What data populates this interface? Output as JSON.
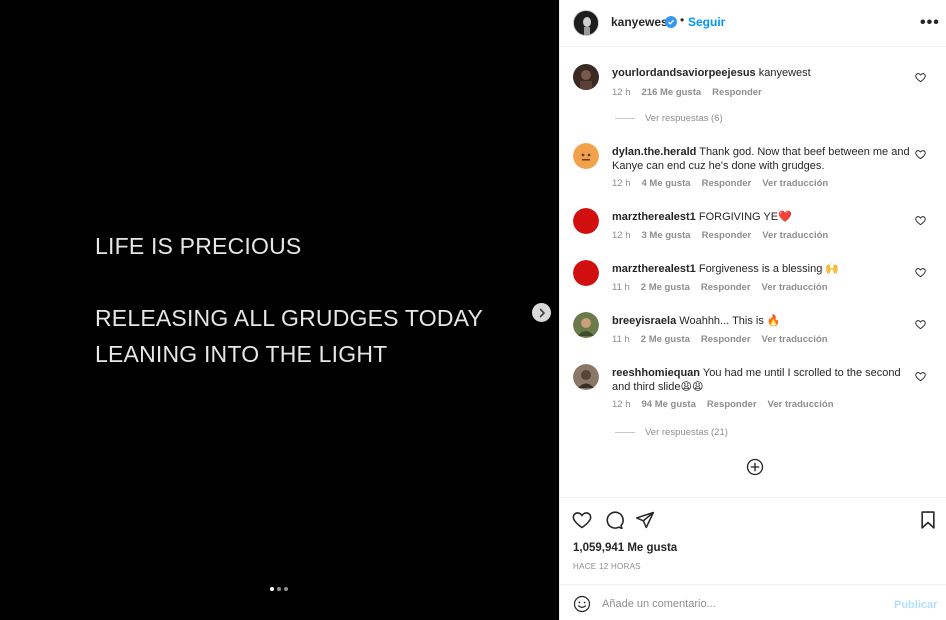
{
  "slide": {
    "lines": [
      "LIFE IS PRECIOUS",
      "RELEASING ALL GRUDGES TODAY",
      "LEANING INTO THE LIGHT"
    ],
    "dots": 3,
    "active_dot": 0
  },
  "header": {
    "username": "kanyewest",
    "separator": "•",
    "follow_label": "Seguir",
    "more_label": "•••"
  },
  "comments": [
    {
      "user": "yourlordandsaviorpeejesus",
      "text": "kanyewest",
      "time": "12 h",
      "likes": "216 Me gusta",
      "reply": "Responder",
      "translate": "",
      "avatar_color": "#3a2a22"
    },
    {
      "user": "dylan.the.herald",
      "text": "Thank god. Now that beef between me and Kanye can end cuz he's done with grudges.",
      "time": "12 h",
      "likes": "4 Me gusta",
      "reply": "Responder",
      "translate": "Ver traducción",
      "avatar_color": "#f5a04a"
    },
    {
      "user": "marztherealest1",
      "text": "FORGIVING YE❤️",
      "time": "12 h",
      "likes": "3 Me gusta",
      "reply": "Responder",
      "translate": "Ver traducción",
      "avatar_color": "#d10f0f"
    },
    {
      "user": "marztherealest1",
      "text": "Forgiveness is a blessing 🙌",
      "time": "11 h",
      "likes": "2 Me gusta",
      "reply": "Responder",
      "translate": "Ver traducción",
      "avatar_color": "#d10f0f"
    },
    {
      "user": "breeyisraela",
      "text": "Woahhh... This is 🔥",
      "time": "11 h",
      "likes": "2 Me gusta",
      "reply": "Responder",
      "translate": "Ver traducción",
      "avatar_color": "#6b7a4a"
    },
    {
      "user": "reeshhomiequan",
      "text": "You had me until I scrolled to the second and third slide😩😩",
      "time": "12 h",
      "likes": "94 Me gusta",
      "reply": "Responder",
      "translate": "Ver traducción",
      "avatar_color": "#7a6a5a"
    }
  ],
  "replies": [
    {
      "label": "Ver respuestas (6)"
    },
    {
      "label": "Ver respuestas (21)"
    }
  ],
  "actions": {
    "likes": "1,059,941 Me gusta",
    "time": "HACE 12 HORAS"
  },
  "composer": {
    "placeholder": "Añade un comentario...",
    "publish_label": "Publicar"
  },
  "colors": {
    "accent": "#0095f6",
    "publish_disabled": "#b2dffc",
    "muted": "#8e8e8e"
  }
}
